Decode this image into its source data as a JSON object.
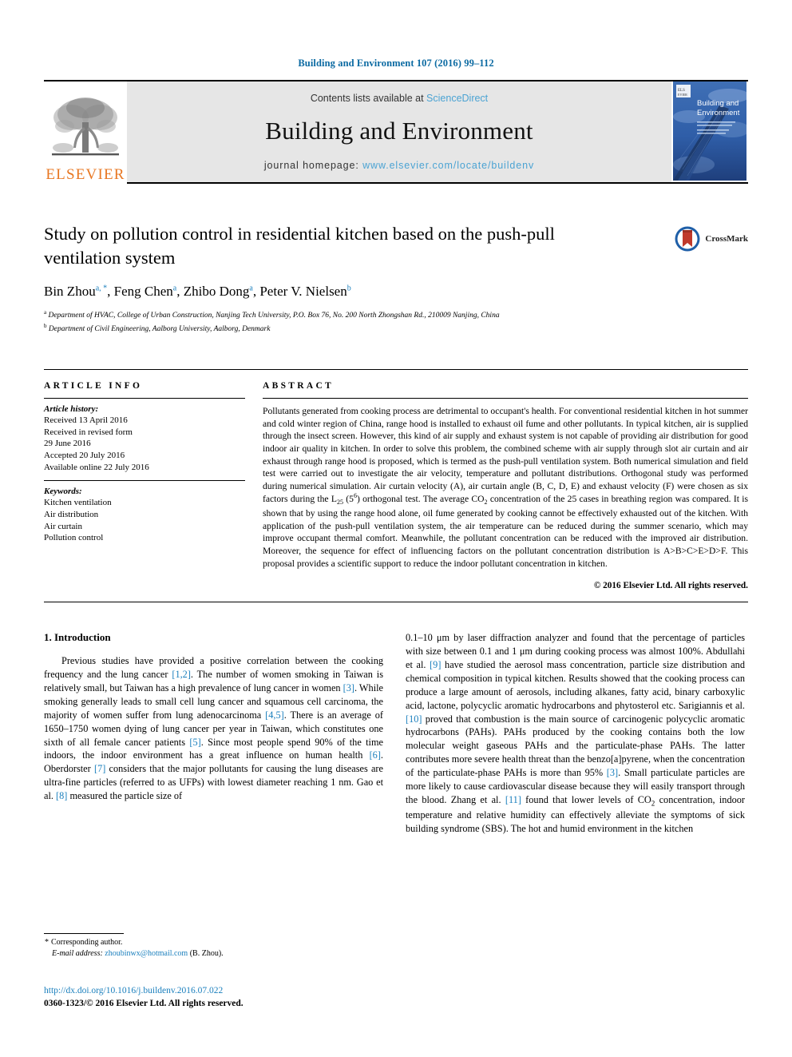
{
  "running_head": "Building and Environment 107 (2016) 99–112",
  "masthead": {
    "publisher_logo_text": "ELSEVIER",
    "contents_prefix": "Contents lists available at ",
    "contents_link": "ScienceDirect",
    "journal_name": "Building and Environment",
    "homepage_prefix": "journal homepage: ",
    "homepage_url": "www.elsevier.com/locate/buildenv",
    "cover_title_line1": "Building and",
    "cover_title_line2": "Environment",
    "colors": {
      "link_blue": "#4ba3d3",
      "elsevier_orange": "#E87722",
      "masthead_gray": "#e6e6e6",
      "cover_blue": "#2f5ea8"
    }
  },
  "article": {
    "title": "Study on pollution control in residential kitchen based on the push-pull ventilation system",
    "authors": "Bin Zhou a,*, Feng Chen a, Zhibo Dong a, Peter V. Nielsen b",
    "author_list": [
      {
        "name": "Bin Zhou",
        "marks": "a, *"
      },
      {
        "name": "Feng Chen",
        "marks": "a"
      },
      {
        "name": "Zhibo Dong",
        "marks": "a"
      },
      {
        "name": "Peter V. Nielsen",
        "marks": "b"
      }
    ],
    "affiliations": [
      {
        "mark": "a",
        "text": "Department of HVAC, College of Urban Construction, Nanjing Tech University, P.O. Box 76, No. 200 North Zhongshan Rd., 210009 Nanjing, China"
      },
      {
        "mark": "b",
        "text": "Department of Civil Engineering, Aalborg University, Aalborg, Denmark"
      }
    ],
    "crossmark_label": "CrossMark"
  },
  "article_info": {
    "heading": "ARTICLE INFO",
    "history_label": "Article history:",
    "history": [
      "Received 13 April 2016",
      "Received in revised form",
      "29 June 2016",
      "Accepted 20 July 2016",
      "Available online 22 July 2016"
    ],
    "keywords_label": "Keywords:",
    "keywords": [
      "Kitchen ventilation",
      "Air distribution",
      "Air curtain",
      "Pollution control"
    ]
  },
  "abstract": {
    "heading": "ABSTRACT",
    "paragraph_part1": "Pollutants generated from cooking process are detrimental to occupant's health. For conventional residential kitchen in hot summer and cold winter region of China, range hood is installed to exhaust oil fume and other pollutants. In typical kitchen, air is supplied through the insect screen. However, this kind of air supply and exhaust system is not capable of providing air distribution for good indoor air quality in kitchen. In order to solve this problem, the combined scheme with air supply through slot air curtain and air exhaust through range hood is proposed, which is termed as the push-pull ventilation system. Both numerical simulation and field test were carried out to investigate the air velocity, temperature and pollutant distributions. Orthogonal study was performed during numerical simulation. Air curtain velocity (A), air curtain angle (B, C, D, E) and exhaust velocity (F) were chosen as six factors during the L",
    "l_subscript": "25",
    "paren_open": " (5",
    "exp_superscript": "6",
    "paragraph_part2": ") orthogonal test. The average CO",
    "co2_subscript": "2",
    "paragraph_part3": " concentration of the 25 cases in breathing region was compared. It is shown that by using the range hood alone, oil fume generated by cooking cannot be effectively exhausted out of the kitchen. With application of the push-pull ventilation system, the air temperature can be reduced during the summer scenario, which may improve occupant thermal comfort. Meanwhile, the pollutant concentration can be reduced with the improved air distribution. Moreover, the sequence for effect of influencing factors on the pollutant concentration distribution is A>B>C>E>D>F. This proposal provides a scientific support to reduce the indoor pollutant concentration in kitchen.",
    "copyright": "© 2016 Elsevier Ltd. All rights reserved."
  },
  "body": {
    "section_number_title": "1. Introduction",
    "left_column": {
      "p1_a": "Previous studies have provided a positive correlation between the cooking frequency and the lung cancer ",
      "cite1": "[1,2]",
      "p1_b": ". The number of women smoking in Taiwan is relatively small, but Taiwan has a high prevalence of lung cancer in women ",
      "cite2": "[3]",
      "p1_c": ". While smoking generally leads to small cell lung cancer and squamous cell carcinoma, the majority of women suffer from lung adenocarcinoma ",
      "cite3": "[4,5]",
      "p1_d": ". There is an average of 1650–1750 women dying of lung cancer per year in Taiwan, which constitutes one sixth of all female cancer patients ",
      "cite4": "[5]",
      "p1_e": ". Since most people spend 90% of the time indoors, the indoor environment has a great influence on human health ",
      "cite5": "[6]",
      "p1_f": ". Oberdorster ",
      "cite6": "[7]",
      "p1_g": " considers that the major pollutants for causing the lung diseases are ultra-fine particles (referred to as UFPs) with lowest diameter reaching 1 nm. Gao et al. ",
      "cite7": "[8]",
      "p1_h": " measured the particle size of"
    },
    "right_column": {
      "p_a": "0.1–10 μm by laser diffraction analyzer and found that the percentage of particles with size between 0.1 and 1 μm during cooking process was almost 100%. Abdullahi et al. ",
      "cite8": "[9]",
      "p_b": " have studied the aerosol mass concentration, particle size distribution and chemical composition in typical kitchen. Results showed that the cooking process can produce a large amount of aerosols, including alkanes, fatty acid, binary carboxylic acid, lactone, polycyclic aromatic hydrocarbons and phytosterol etc. Sarigiannis et al. ",
      "cite9": "[10]",
      "p_c": " proved that combustion is the main source of carcinogenic polycyclic aromatic hydrocarbons (PAHs). PAHs produced by the cooking contains both the low molecular weight gaseous PAHs and the particulate-phase PAHs. The latter contributes more severe health threat than the benzo[a]pyrene, when the concentration of the particulate-phase PAHs is more than 95% ",
      "cite10": "[3]",
      "p_d": ". Small particulate particles are more likely to cause cardiovascular disease because they will easily transport through the blood. Zhang et al. ",
      "cite11": "[11]",
      "p_e": " found that lower levels of CO",
      "co2_sub": "2",
      "p_f": " concentration, indoor temperature and relative humidity can effectively alleviate the symptoms of sick building syndrome (SBS). The hot and humid environment in the kitchen"
    }
  },
  "footer": {
    "corresponding_star": "*",
    "corresponding_label": "Corresponding author.",
    "email_label": "E-mail address:",
    "email": "zhoubinwx@hotmail.com",
    "email_owner": "(B. Zhou).",
    "doi": "http://dx.doi.org/10.1016/j.buildenv.2016.07.022",
    "issn_line": "0360-1323/© 2016 Elsevier Ltd. All rights reserved."
  }
}
